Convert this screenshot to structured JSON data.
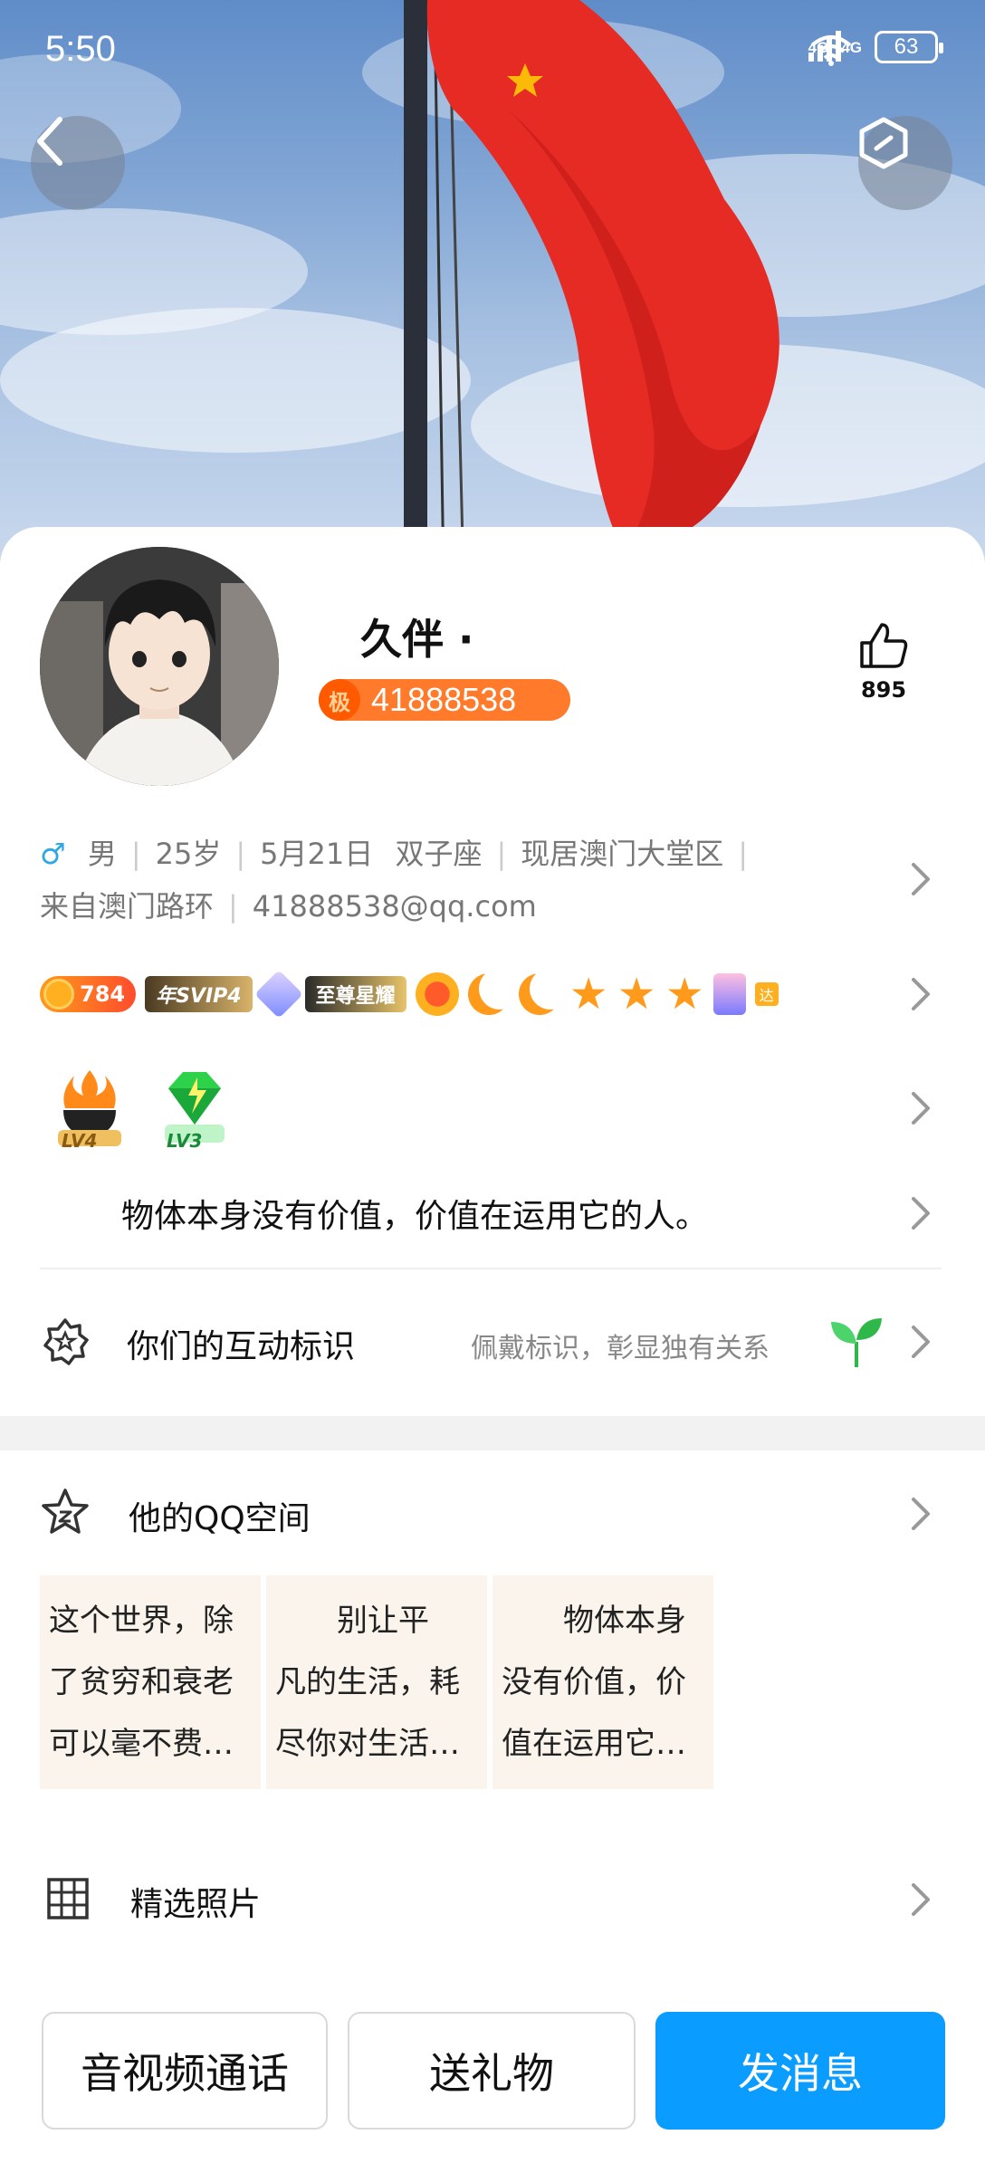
{
  "status_bar": {
    "time": "5:50",
    "signal_1": "4G",
    "signal_2": "4G",
    "wifi_badge": "6",
    "battery": "63"
  },
  "header": {
    "back_icon": "chevron-left-icon",
    "settings_icon": "hexagon-settings-icon"
  },
  "profile": {
    "nickname": "久伴 ·",
    "qq_level_badge": "极",
    "qq_number": "41888538",
    "likes": "895",
    "gender_symbol": "♂",
    "gender": "男",
    "age": "25岁",
    "birthday": "5月21日",
    "zodiac": "双子座",
    "location": "现居澳门大堂区",
    "hometown": "来自澳门路环",
    "email": "41888538@qq.com"
  },
  "badges": {
    "points": "784",
    "svip": "年SVIP4",
    "supreme": "至尊星耀",
    "last_badge": "达"
  },
  "levels": [
    {
      "label": "LV4"
    },
    {
      "label": "LV3"
    }
  ],
  "signature": "物体本身没有价值，价值在运用它的人。",
  "interaction": {
    "title": "你们的互动标识",
    "desc": "佩戴标识，彰显独有关系"
  },
  "qzone": {
    "title": "他的QQ空间",
    "posts": [
      {
        "l1": "这个世界，除",
        "l2": "了贫穷和衰老",
        "l3": "可以毫不费…"
      },
      {
        "l1": "　　别让平",
        "l2": "凡的生活，耗",
        "l3": "尽你对生活…"
      },
      {
        "l1": "　　物体本身",
        "l2": "没有价值，价",
        "l3": "值在运用它…"
      }
    ]
  },
  "photos": {
    "title": "精选照片"
  },
  "actions": {
    "call": "音视频通话",
    "gift": "送礼物",
    "message": "发消息"
  },
  "colors": {
    "accent": "#0a9cff",
    "qq_badge": "#ff7a2a",
    "male": "#2da7e6"
  }
}
